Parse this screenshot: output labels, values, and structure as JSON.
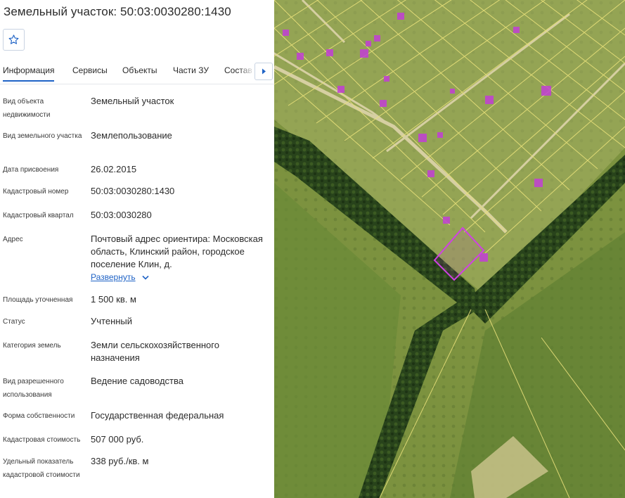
{
  "header": {
    "title": "Земельный участок: 50:03:0030280:1430"
  },
  "tabs": [
    {
      "label": "Информация",
      "active": true
    },
    {
      "label": "Сервисы",
      "active": false
    },
    {
      "label": "Объекты",
      "active": false
    },
    {
      "label": "Части ЗУ",
      "active": false
    },
    {
      "label": "Состав ЕЗП",
      "active": false
    }
  ],
  "icons": {
    "favorite": "star-outline-icon",
    "tabs_next": "triangle-right-icon",
    "expand": "chevron-down-icon"
  },
  "properties": {
    "object_type": {
      "label": "Вид объекта недвижимости",
      "value": "Земельный участок"
    },
    "land_plot_type": {
      "label": "Вид земельного участка",
      "value": "Землепользование"
    },
    "assignment_date": {
      "label": "Дата присвоения",
      "value": "26.02.2015"
    },
    "cadastral_number": {
      "label": "Кадастровый номер",
      "value": "50:03:0030280:1430"
    },
    "cadastral_quarter": {
      "label": "Кадастровый квартал",
      "value": "50:03:0030280"
    },
    "address": {
      "label": "Адрес",
      "value": "Почтовый адрес ориентира: Московская область, Клинский район, городское поселение Клин, д.",
      "expand_label": "Развернуть"
    },
    "area": {
      "label": "Площадь уточненная",
      "value": "1 500 кв. м"
    },
    "status": {
      "label": "Статус",
      "value": "Учтенный"
    },
    "land_category": {
      "label": "Категория земель",
      "value": "Земли сельскохозяйственного назначения"
    },
    "permitted_use": {
      "label": "Вид разрешенного использования",
      "value": "Ведение садоводства"
    },
    "ownership": {
      "label": "Форма собственности",
      "value": "Государственная федеральная"
    },
    "cadastral_value": {
      "label": "Кадастровая стоимость",
      "value": "507 000 руб."
    },
    "specific_value": {
      "label": "Удельный показатель кадастровой стоимости",
      "value": "338 руб./кв. м"
    }
  },
  "colors": {
    "accent": "#1f63c6",
    "parcel_border": "#e8e07a",
    "selected_parcel": "#c23fd6",
    "building_marker": "#c23fd6"
  }
}
